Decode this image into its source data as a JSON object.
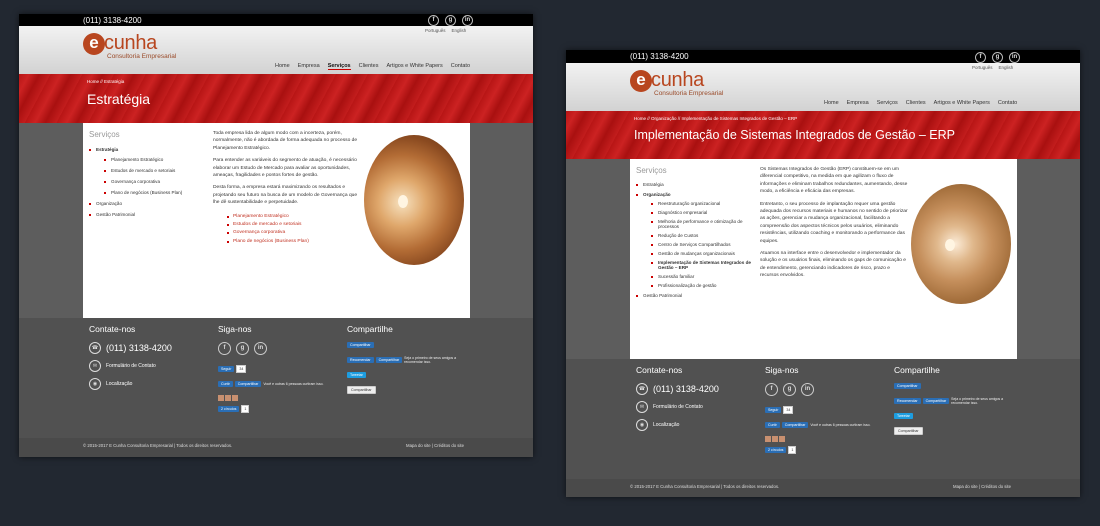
{
  "site": {
    "phone": "(011) 3138-4200",
    "logo_word": "cunha",
    "logo_letter": "e",
    "logo_tagline": "Consultoria Empresarial",
    "languages": [
      "Português",
      "English"
    ],
    "social_icons": [
      "facebook-icon",
      "google-plus-icon",
      "linkedin-icon"
    ],
    "nav": [
      "Home",
      "Empresa",
      "Serviços",
      "Clientes",
      "Artigos e White Papers",
      "Contato"
    ],
    "nav_active": "Serviços"
  },
  "left_page": {
    "breadcrumb": "Home // Estratégia",
    "title": "Estratégia",
    "sidebar": {
      "title": "Serviços",
      "items": [
        {
          "label": "Estratégia",
          "bold": true,
          "sub": [
            "Planejamento Estratégico",
            "Estudos de mercado e setoriais",
            "Governança corporativa",
            "Plano de negócios (Business Plan)"
          ]
        },
        {
          "label": "Organização",
          "bold": false,
          "sub": []
        },
        {
          "label": "Gestão Patrimonial",
          "bold": false,
          "sub": []
        }
      ]
    },
    "paragraphs": [
      "Toda empresa lida de algum modo com a incerteza, porém, normalmente, não é abordada de forma adequada no processo de Planejamento Estratégico.",
      "Para entender as variáveis do segmento de atuação, é necessário elaborar um Estudo de Mercado para avaliar as oportunidades, ameaças, fragilidades e pontos fortes de gestão.",
      "Desta forma, a empresa estará maximizando os resultados e projetando seu futuro na busca de um modelo de Governança que lhe dê sustentabilidade e perpetuidade."
    ],
    "links": [
      "Planejamento Estratégico",
      "Estudos de mercado e setoriais",
      "Governança corporativa",
      "Plano de negócios (Business Plan)"
    ]
  },
  "right_page": {
    "breadcrumb": "Home // Organização // Implementação de Sistemas Integrados de Gestão – ERP",
    "title": "Implementação de Sistemas Integrados de Gestão – ERP",
    "sidebar": {
      "title": "Serviços",
      "items": [
        {
          "label": "Estratégia",
          "bold": false,
          "sub": []
        },
        {
          "label": "Organização",
          "bold": true,
          "sub": [
            "Reestruturação organizacional",
            "Diagnóstico empresarial",
            "Melhoria de performance e otimização de processos",
            "Redução de Custos",
            "Centro de Serviços Compartilhados",
            "Gestão de mudanças organizacionais",
            "Implementação de Sistemas Integrados de Gestão – ERP",
            "Sucessão familiar",
            "Profissionalização de gestão"
          ]
        },
        {
          "label": "Gestão Patrimonial",
          "bold": false,
          "sub": []
        }
      ]
    },
    "paragraphs": [
      "Os Sistemas Integrados de Gestão (ERP) constituem-se em um diferencial competitivo, na medida em que agilizam o fluxo de informações e eliminam trabalhos redundantes, aumentando, desse modo, a eficiência e eficácia das empresas.",
      "Entretanto, o seu processo de implantação requer uma gestão adequada dos recursos materiais e humanos no sentido de priorizar as ações, gerenciar a mudança organizacional, facilitando a compreensão dos aspectos técnicos pelos usuários, eliminando resistências, utilizando coaching e monitorando a performance das equipes.",
      "Atuamos na interface entre o desenvolvedor e implementador da solução e os usuários finais, eliminando os gaps de comunicação e de entendimento, gerenciando indicadores de risco, prazo e recursos envolvidos."
    ]
  },
  "footer": {
    "contact_title": "Contate-nos",
    "contact_phone": "(011) 3138-4200",
    "contact_form": "Formulário de Contato",
    "contact_location": "Localização",
    "follow_title": "Siga-nos",
    "follow_linkedin": "Seguir",
    "follow_linkedin_count": "34",
    "like": "Curtir",
    "share": "Compartilhar",
    "like_text": "Você e outras 6 pessoas curtiram isso.",
    "gplus": "2 círculos",
    "gplus_count": "1",
    "share_title": "Compartilhe",
    "share_linkedin": "Compartilhar",
    "recommend": "Recomendar",
    "recommend_text": "Seja o primeiro de seus amigos a recomendar isso.",
    "tweet": "Tweetar",
    "gshare": "Compartilhar",
    "copyright": "© 2015-2017 E Cunha Consultoria Empresarial | Todos os direitos reservados.",
    "sitemap": "Mapa do site",
    "credits": "Créditos do site"
  }
}
